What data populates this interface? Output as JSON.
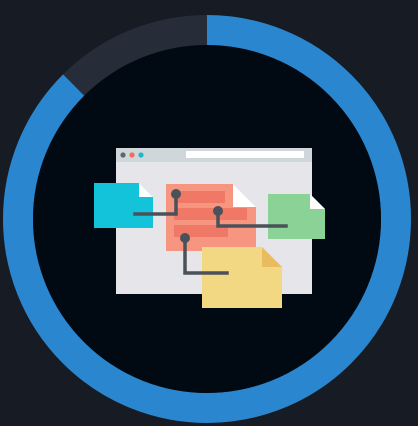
{
  "progress": {
    "value": 0.875,
    "track_color": "#262d38",
    "fill_color": "#2a86cf"
  },
  "illustration": {
    "icon": "file-transfer-icon",
    "colors": {
      "inner_disc": "#010912",
      "browser_window": "#e6e6ea",
      "browser_bar": "#d0d7db",
      "address_bar": "#ffffff",
      "dot_gray": "#5b6670",
      "dot_red": "#f16d5a",
      "dot_teal": "#1fb8c8",
      "doc_cyan": "#13c3da",
      "doc_salmon": "#f69580",
      "doc_salmon_dark": "#ef7966",
      "doc_green": "#8ad295",
      "doc_yellow": "#f3d884",
      "doc_yellow_fold": "#e9bd5f",
      "connector": "#4a5159"
    }
  }
}
